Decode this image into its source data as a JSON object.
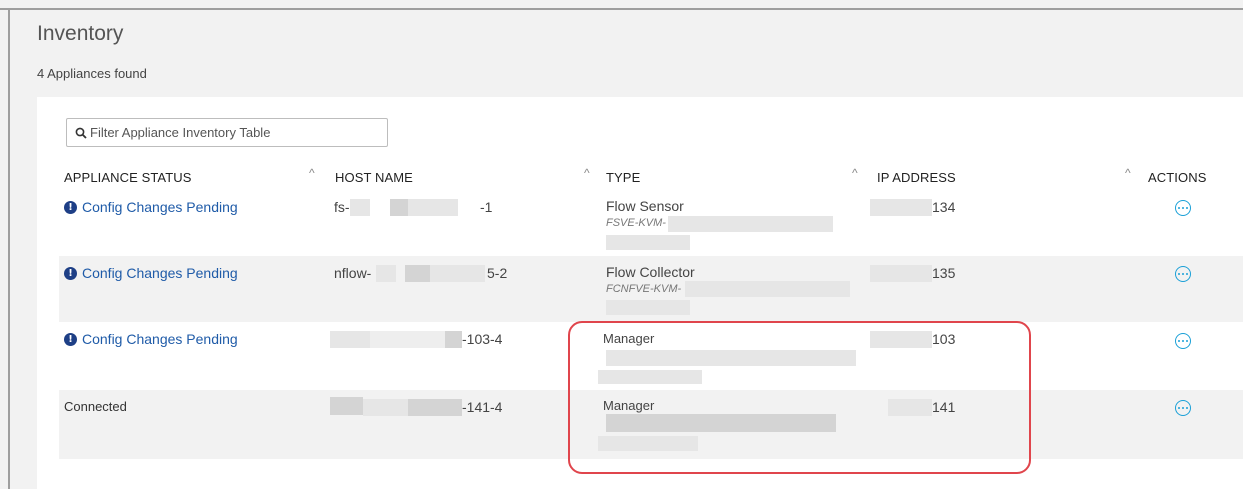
{
  "page": {
    "title": "Inventory",
    "found_text": "4 Appliances found"
  },
  "filter": {
    "placeholder": "Filter Appliance Inventory Table"
  },
  "table": {
    "headers": [
      "APPLIANCE STATUS",
      "HOST NAME",
      "TYPE",
      "IP ADDRESS",
      "ACTIONS"
    ],
    "sort_glyph": "^",
    "rows": [
      {
        "status": "Config Changes Pending",
        "status_kind": "pending",
        "host_prefix": "fs-",
        "host_suffix": "-1",
        "type": "Flow Sensor",
        "type_sub": "FSVE-KVM-",
        "ip_suffix": "134"
      },
      {
        "status": "Config Changes Pending",
        "status_kind": "pending",
        "host_prefix": "nflow-",
        "host_suffix": "5-2",
        "type": "Flow Collector",
        "type_sub": "FCNFVE-KVM-",
        "ip_suffix": "135"
      },
      {
        "status": "Config Changes Pending",
        "status_kind": "pending",
        "host_prefix": "",
        "host_suffix": "-103-4",
        "type": "Manager",
        "type_sub": "",
        "ip_suffix": "103"
      },
      {
        "status": "Connected",
        "status_kind": "connected",
        "host_prefix": "",
        "host_suffix": "-141-4",
        "type": "Manager",
        "type_sub": "",
        "ip_suffix": "141"
      }
    ]
  },
  "icons": {
    "pending": "exclamation-circle-icon",
    "actions": "more-horizontal-circle-icon",
    "filter": "search-icon"
  },
  "colors": {
    "link": "#1f5ba8",
    "action": "#1ba0d7",
    "highlight": "#e0454c"
  }
}
